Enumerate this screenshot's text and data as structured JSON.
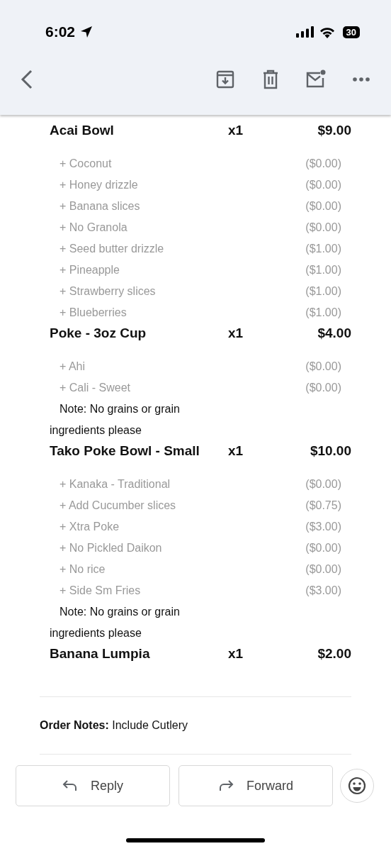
{
  "status_bar": {
    "time": "6:02",
    "battery": "30"
  },
  "items": [
    {
      "name": "Acai Bowl",
      "qty": "x1",
      "price": "$9.00",
      "modifiers": [
        {
          "name": "+ Coconut",
          "price": "($0.00)"
        },
        {
          "name": "+ Honey drizzle",
          "price": "($0.00)"
        },
        {
          "name": "+ Banana slices",
          "price": "($0.00)"
        },
        {
          "name": "+ No Granola",
          "price": "($0.00)"
        },
        {
          "name": "+ Seed butter drizzle",
          "price": "($1.00)"
        },
        {
          "name": "+ Pineapple",
          "price": "($1.00)"
        },
        {
          "name": "+ Strawberry slices",
          "price": "($1.00)"
        },
        {
          "name": "+ Blueberries",
          "price": "($1.00)"
        }
      ]
    },
    {
      "name": "Poke - 3oz Cup",
      "qty": "x1",
      "price": "$4.00",
      "modifiers": [
        {
          "name": "+ Ahi",
          "price": "($0.00)"
        },
        {
          "name": "+ Cali - Sweet",
          "price": "($0.00)"
        }
      ],
      "note": "Note: No grains or grain ingredients please"
    },
    {
      "name": "Tako Poke Bowl - Small",
      "qty": "x1",
      "price": "$10.00",
      "modifiers": [
        {
          "name": "+ Kanaka - Traditional",
          "price": "($0.00)"
        },
        {
          "name": "+ Add Cucumber slices",
          "price": "($0.75)"
        },
        {
          "name": "+ Xtra Poke",
          "price": "($3.00)"
        },
        {
          "name": "+ No Pickled Daikon",
          "price": "($0.00)"
        },
        {
          "name": "+ No rice",
          "price": "($0.00)"
        },
        {
          "name": "+ Side Sm Fries",
          "price": "($3.00)"
        }
      ],
      "note": "Note: No grains or grain ingredients please"
    },
    {
      "name": "Banana Lumpia",
      "qty": "x1",
      "price": "$2.00"
    }
  ],
  "order_notes": "**Order Notes:** Include Cutlery",
  "actions": [
    {
      "label": "Reply",
      "kind": "reply"
    },
    {
      "label": "Forward",
      "kind": "forward"
    }
  ]
}
